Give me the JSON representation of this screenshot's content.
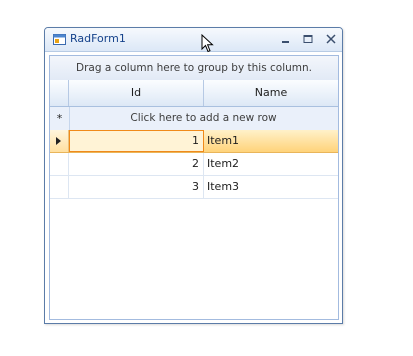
{
  "window": {
    "title": "RadForm1",
    "icon": "form-icon",
    "controls": [
      "minimize-icon",
      "maximize-icon",
      "close-icon"
    ]
  },
  "grid": {
    "group_panel_text": "Drag a column here to group by this column.",
    "columns": [
      "Id",
      "Name"
    ],
    "new_row": {
      "indicator": "*",
      "text": "Click here to add a new row"
    },
    "rows": [
      {
        "id": "1",
        "name": "Item1",
        "selected": true
      },
      {
        "id": "2",
        "name": "Item2",
        "selected": false
      },
      {
        "id": "3",
        "name": "Item3",
        "selected": false
      }
    ]
  },
  "colors": {
    "title_text": "#15428b",
    "selected_row": "#ffd37a",
    "current_cell_border": "#f08a1a"
  }
}
